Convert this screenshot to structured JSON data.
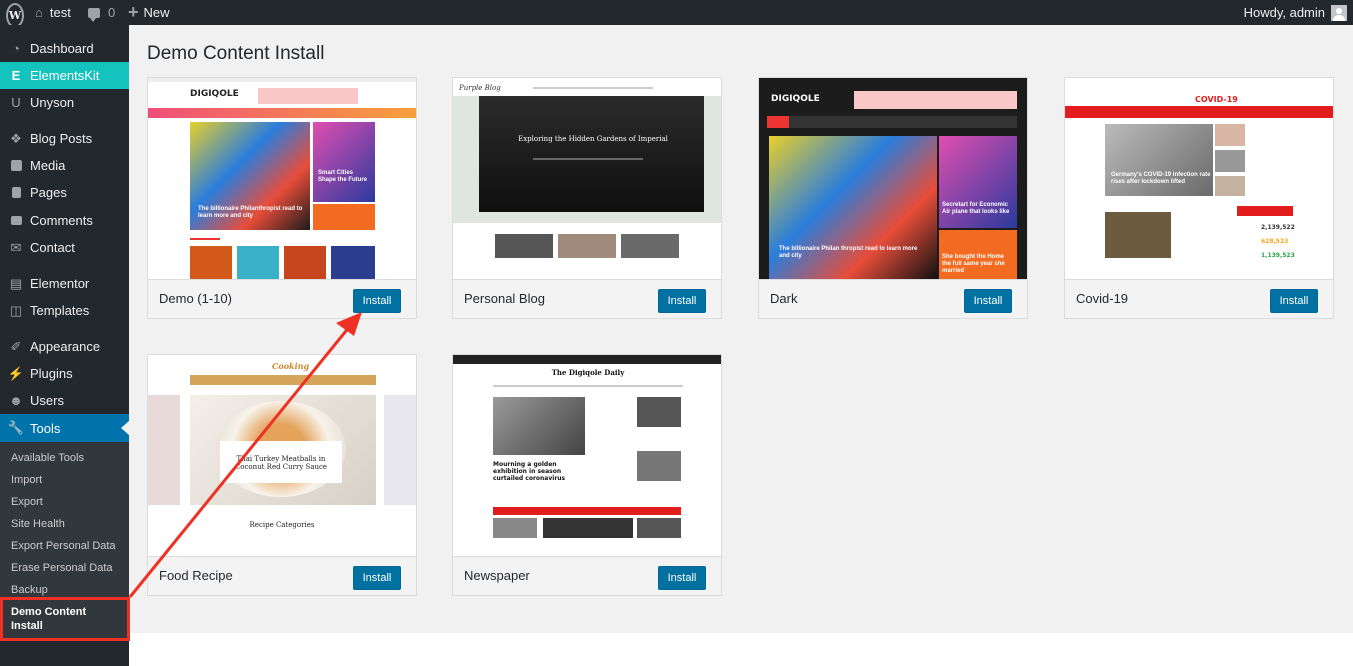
{
  "admin_bar": {
    "site_name": "test",
    "comments_count": "0",
    "new_label": "New",
    "howdy": "Howdy, admin"
  },
  "sidebar": {
    "items": [
      {
        "label": "Dashboard",
        "icon": "dashboard-icon"
      },
      {
        "label": "ElementsKit",
        "icon": "elementskit-icon"
      },
      {
        "label": "Unyson",
        "icon": "unyson-icon"
      },
      {
        "label": "Blog Posts",
        "icon": "pin-icon"
      },
      {
        "label": "Media",
        "icon": "media-icon"
      },
      {
        "label": "Pages",
        "icon": "pages-icon"
      },
      {
        "label": "Comments",
        "icon": "comments-icon"
      },
      {
        "label": "Contact",
        "icon": "mail-icon"
      },
      {
        "label": "Elementor",
        "icon": "elementor-icon"
      },
      {
        "label": "Templates",
        "icon": "folder-icon"
      },
      {
        "label": "Appearance",
        "icon": "brush-icon"
      },
      {
        "label": "Plugins",
        "icon": "plug-icon"
      },
      {
        "label": "Users",
        "icon": "users-icon"
      },
      {
        "label": "Tools",
        "icon": "wrench-icon"
      }
    ],
    "tools_submenu": [
      "Available Tools",
      "Import",
      "Export",
      "Site Health",
      "Export Personal Data",
      "Erase Personal Data",
      "Backup",
      "Demo Content Install"
    ]
  },
  "page": {
    "title": "Demo Content Install",
    "install_label": "Install"
  },
  "demos": [
    {
      "name": "Demo (1-10)"
    },
    {
      "name": "Personal Blog"
    },
    {
      "name": "Dark"
    },
    {
      "name": "Covid-19"
    },
    {
      "name": "Food Recipe"
    },
    {
      "name": "Newspaper"
    }
  ],
  "thumbnails": {
    "digiqole_logo": "DIGIQOLE",
    "demo_headline": "The billionaire Philanthropist read to learn more and city",
    "demo_side": "Smart Cities Shape the Future",
    "blog_logo": "Purple Blog",
    "blog_headline": "Exploring the Hidden Gardens of Imperial",
    "dark_headline": "The billionaire Philan thropist read to learn more and city",
    "dark_side1": "Secretart for Economic Air plane that looks like",
    "dark_side2": "She bought the Home the full same year she married",
    "covid_logo": "COVID-19",
    "covid_headline": "Germany's COVID-19 infection rate rises after lockdown lifted",
    "covid_stats": [
      "2,139,522",
      "628,523",
      "1,139,523"
    ],
    "food_logo": "Cooking",
    "food_headline": "Thai Turkey Meatballs in Coconut Red Curry Sauce",
    "food_categories": "Recipe Categories",
    "news_logo": "The Digiqole Daily",
    "news_headline": "Mourning a golden exhibition in season curtailed coronavirus"
  },
  "colors": {
    "admin_bg": "#23282d",
    "elementskit": "#14c2be",
    "active_blue": "#0073aa",
    "button_blue": "#0071a1",
    "annotation_red": "#ee3124"
  }
}
